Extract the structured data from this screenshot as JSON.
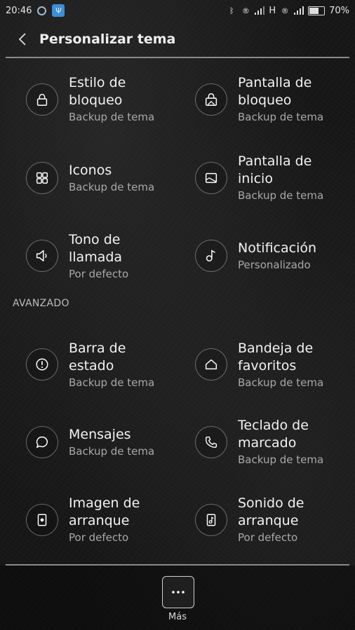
{
  "status": {
    "time": "20:46",
    "network_type": "H",
    "battery": "70%",
    "battery_level": 0.7
  },
  "header": {
    "title": "Personalizar tema"
  },
  "items_top": [
    {
      "name": "Estilo de\nbloqueo",
      "sub": "Backup de tema",
      "icon": "lock-icon"
    },
    {
      "name": "Pantalla de\nbloqueo",
      "sub": "Backup de tema",
      "icon": "lockscreen-icon"
    },
    {
      "name": "Iconos",
      "sub": "Backup de tema",
      "icon": "grid-icon"
    },
    {
      "name": "Pantalla de\ninicio",
      "sub": "Backup de tema",
      "icon": "homescreen-icon"
    },
    {
      "name": "Tono de llamada",
      "sub": "Por defecto",
      "icon": "speaker-icon"
    },
    {
      "name": "Notificación",
      "sub": "Personalizado",
      "icon": "music-note-icon"
    }
  ],
  "section_advanced": "AVANZADO",
  "items_advanced": [
    {
      "name": "Barra de estado",
      "sub": "Backup de tema",
      "icon": "alert-icon"
    },
    {
      "name": "Bandeja de\nfavoritos",
      "sub": "Backup de tema",
      "icon": "house-icon"
    },
    {
      "name": "Mensajes",
      "sub": "Backup de tema",
      "icon": "chat-bubble-icon"
    },
    {
      "name": "Teclado de\nmarcado",
      "sub": "Backup de tema",
      "icon": "phone-icon"
    },
    {
      "name": "Imagen de\narranque",
      "sub": "Por defecto",
      "icon": "boot-image-icon"
    },
    {
      "name": "Sonido de\narranque",
      "sub": "Por defecto",
      "icon": "boot-sound-icon"
    }
  ],
  "bottom": {
    "more_label": "Más"
  }
}
